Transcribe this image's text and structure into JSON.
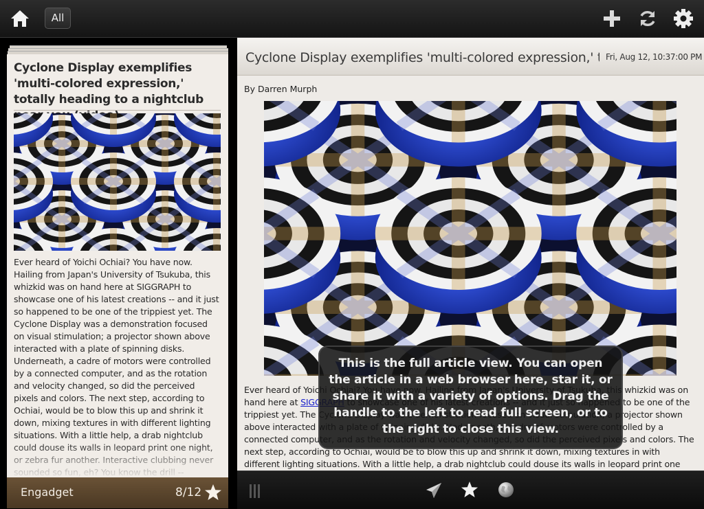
{
  "toolbar": {
    "home_icon": "home-icon",
    "filter_label": "All",
    "add_icon": "plus-icon",
    "refresh_icon": "refresh-icon",
    "settings_icon": "gear-icon"
  },
  "card": {
    "title": "Cyclone Display exemplifies 'multi-colored expression,' totally heading to a nightclub near you (video)",
    "text": "Ever heard of Yoichi Ochiai? You have now. Hailing from Japan's University of Tsukuba, this whizkid was on hand here at SIGGRAPH to showcase one of his latest creations -- and it just so happened to be one of the trippiest yet. The Cyclone Display was a demonstration focused on visual stimulation; a projector shown above interacted with a plate of spinning disks. Underneath, a cadre of motors were controlled by a connected computer, and as the rotation and velocity changed, so did the perceived pixels and colors. The next step, according to Ochiai, would be to blow this up and shrink it down, mixing textures in with different lighting situations. With a little help, a drab nightclub could douse its walls in leopard print one night, or zebra fur another. Interactive clubbing never sounded so fun, eh? You know the drill -- gallery's below, video's a",
    "source": "Engadget",
    "count": "8/12",
    "star_icon": "star-icon"
  },
  "article": {
    "title": "Cyclone Display exemplifies 'multi-colored expression,' to...",
    "date": "Fri, Aug 12, 10:37:00 PM",
    "author": "By Darren Murph",
    "body_before_link": "Ever heard of Yoichi Ochiai? You have now. Hailing from Japan's University of Tsukuba, this whizkid was on hand here at ",
    "link": "SIGGRAPH",
    "body_after_link": " to showcase one of his latest creations -- and it just so happened to be one of the trippiest yet. The Cyclone Display was a demonstration focused on visual stimulation; a projector shown above interacted with a plate of spinning disks. Underneath, a cadre of motors were controlled by a connected computer, and as the rotation and velocity changed, so did the perceived pixels and colors. The next step, according to Ochiai, would be to blow this up and shrink it down, mixing textures in with different lighting situations. With a little help, a drab nightclub could douse its walls in leopard print one night, or zebra fur another."
  },
  "bottombar": {
    "handle_icon": "drag-handle-icon",
    "share_icon": "paper-plane-icon",
    "star_icon": "star-icon",
    "browser_icon": "globe-icon"
  },
  "tooltip": {
    "text": "This is the full article view.  You can open the article in a web browser here, star it, or share it with a variety of options. Drag the handle to the left to read full screen, or to the right to close this view."
  },
  "colors": {
    "toolbar_bg": "#1c1c1c",
    "card_bg": "#f1ede8",
    "card_footer": "#5a4530",
    "article_bg": "#eeebe7",
    "link": "#1a22cc"
  }
}
